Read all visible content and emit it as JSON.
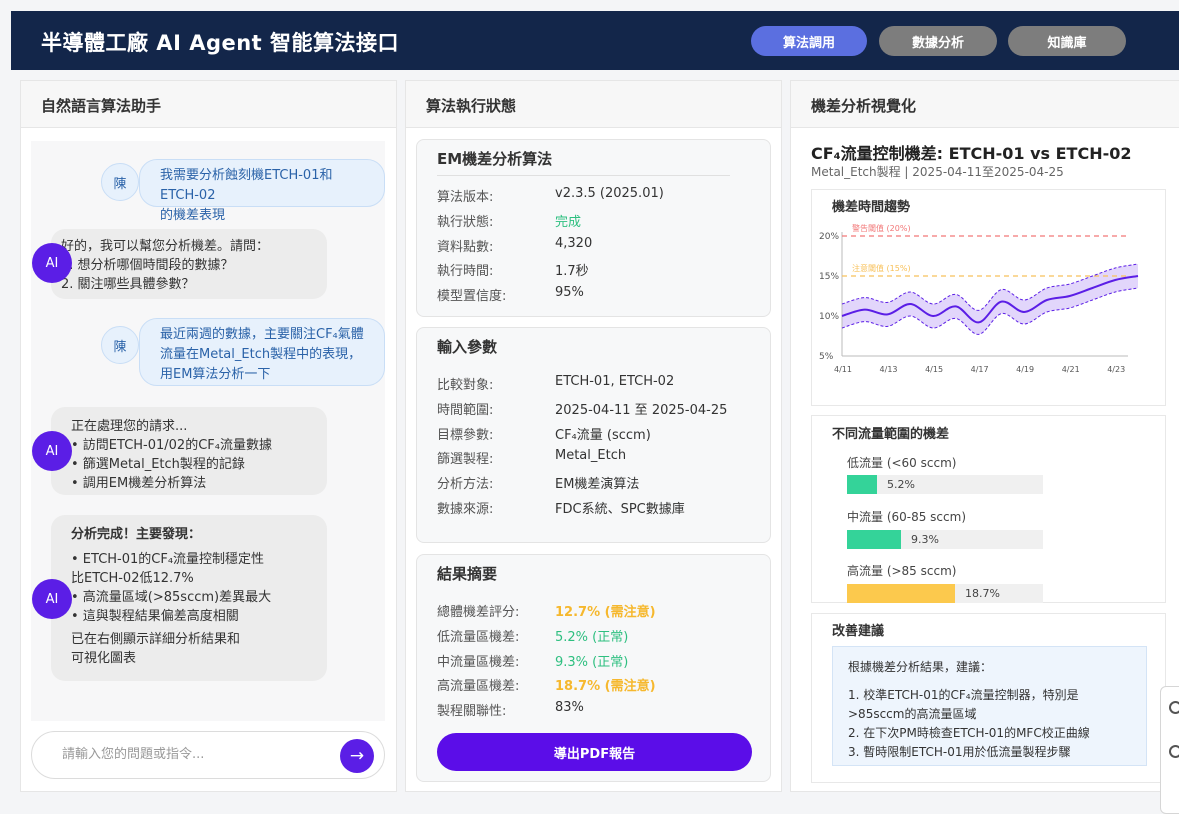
{
  "header": {
    "title": "半導體工廠 AI Agent 智能算法接口",
    "tabs": [
      {
        "label": "算法調用",
        "active": true
      },
      {
        "label": "數據分析",
        "active": false
      },
      {
        "label": "知識庫",
        "active": false
      }
    ]
  },
  "chat": {
    "title": "自然語言算法助手",
    "messages": [
      {
        "role": "user",
        "avatar": "陳",
        "lines": [
          "我需要分析蝕刻機ETCH-01和ETCH-02",
          "的機差表現"
        ]
      },
      {
        "role": "ai",
        "avatar": "AI",
        "lines": [
          "好的，我可以幫您分析機差。請問：",
          "1. 想分析哪個時間段的數據？",
          "2. 關注哪些具體參數？"
        ]
      },
      {
        "role": "user",
        "avatar": "陳",
        "lines": [
          "最近兩週的數據，主要關注CF₄氣體",
          "流量在Metal_Etch製程中的表現，",
          "用EM算法分析一下"
        ]
      },
      {
        "role": "ai",
        "avatar": "AI",
        "lines": [
          "正在處理您的請求...",
          "• 訪問ETCH-01/02的CF₄流量數據",
          "• 篩選Metal_Etch製程的記錄",
          "• 調用EM機差分析算法"
        ]
      },
      {
        "role": "ai",
        "avatar": "AI",
        "heading": "分析完成！主要發現：",
        "lines": [
          "• ETCH-01的CF₄流量控制穩定性",
          "比ETCH-02低12.7%",
          "• 高流量區域(>85sccm)差異最大",
          "• 這與製程結果偏差高度相關",
          "已在右側顯示詳細分析結果和",
          "可視化圖表"
        ]
      }
    ],
    "input_placeholder": "請輸入您的問題或指令...",
    "send_icon": "arrow-right-icon",
    "send_glyph": "→"
  },
  "status": {
    "title": "算法執行狀態",
    "algo_card": {
      "title": "EM機差分析算法",
      "rows": [
        {
          "k": "算法版本:",
          "v": "v2.3.5 (2025.01)"
        },
        {
          "k": "執行狀態:",
          "v": "完成"
        },
        {
          "k": "資料點數:",
          "v": "4,320"
        },
        {
          "k": "執行時間:",
          "v": "1.7秒"
        },
        {
          "k": "模型置信度:",
          "v": "95%"
        }
      ]
    },
    "params_card": {
      "title": "輸入參數",
      "rows": [
        {
          "k": "比較對象:",
          "v": "ETCH-01, ETCH-02"
        },
        {
          "k": "時間範圍:",
          "v": "2025-04-11 至 2025-04-25"
        },
        {
          "k": "目標參數:",
          "v": "CF₄流量 (sccm)"
        },
        {
          "k": "篩選製程:",
          "v": "Metal_Etch"
        },
        {
          "k": "分析方法:",
          "v": "EM機差演算法"
        },
        {
          "k": "數據來源:",
          "v": "FDC系統、SPC數據庫"
        }
      ]
    },
    "result_card": {
      "title": "結果摘要",
      "rows": [
        {
          "k": "總體機差評分:",
          "v": "12.7% (需注意)"
        },
        {
          "k": "低流量區機差:",
          "v": "5.2% (正常)"
        },
        {
          "k": "中流量區機差:",
          "v": "9.3% (正常)"
        },
        {
          "k": "高流量區機差:",
          "v": "18.7% (需注意)"
        },
        {
          "k": "製程關聯性:",
          "v": "83%"
        }
      ],
      "export_label": "導出PDF報告"
    }
  },
  "viz": {
    "title": "機差分析視覺化",
    "chart_title": "CF₄流量控制機差: ETCH-01 vs ETCH-02",
    "chart_subtitle": "Metal_Etch製程 | 2025-04-11至2025-04-25",
    "trend": {
      "title": "機差時間趨勢",
      "warn_label": "警告閾值 (20%)",
      "notice_label": "注意閾值 (15%)",
      "y_ticks": [
        "20%",
        "15%",
        "10%",
        "5%"
      ],
      "x_ticks": [
        "4/11",
        "4/13",
        "4/15",
        "4/17",
        "4/19",
        "4/21",
        "4/23"
      ]
    },
    "ranges": {
      "title": "不同流量範圍的機差",
      "items": [
        {
          "label": "低流量 (<60 sccm)",
          "value": "5.2%",
          "pct": 5.2,
          "color": "#34d399"
        },
        {
          "label": "中流量 (60-85 sccm)",
          "value": "9.3%",
          "pct": 9.3,
          "color": "#34d399"
        },
        {
          "label": "高流量 (>85 sccm)",
          "value": "18.7%",
          "pct": 18.7,
          "color": "#fcc94d"
        }
      ]
    },
    "advice": {
      "title": "改善建議",
      "intro": "根據機差分析結果，建議：",
      "items": [
        "1. 校準ETCH-01的CF₄流量控制器，特別是",
        ">85sccm的高流量區域",
        "2. 在下次PM時檢查ETCH-01的MFC校正曲線",
        "3. 暫時限制ETCH-01用於低流量製程步驟"
      ]
    }
  },
  "chart_data": {
    "type": "line",
    "title": "機差時間趨勢",
    "x": [
      "4/11",
      "4/12",
      "4/13",
      "4/14",
      "4/15",
      "4/16",
      "4/17",
      "4/18",
      "4/19",
      "4/20",
      "4/21",
      "4/22",
      "4/23",
      "4/24"
    ],
    "series": [
      {
        "values": [
          10.0,
          10.8,
          10.2,
          11.5,
          10.0,
          11.2,
          9.2,
          11.8,
          10.5,
          12.0,
          12.5,
          13.5,
          14.5,
          15.0
        ]
      }
    ],
    "band": 1.5,
    "thresholds": [
      {
        "label": "警告閾值 (20%)",
        "value": 20,
        "color": "#f27777"
      },
      {
        "label": "注意閾值 (15%)",
        "value": 15,
        "color": "#f8c15a"
      }
    ],
    "ylim": [
      5,
      20
    ],
    "xlabel": "",
    "ylabel": "",
    "grid": false
  }
}
